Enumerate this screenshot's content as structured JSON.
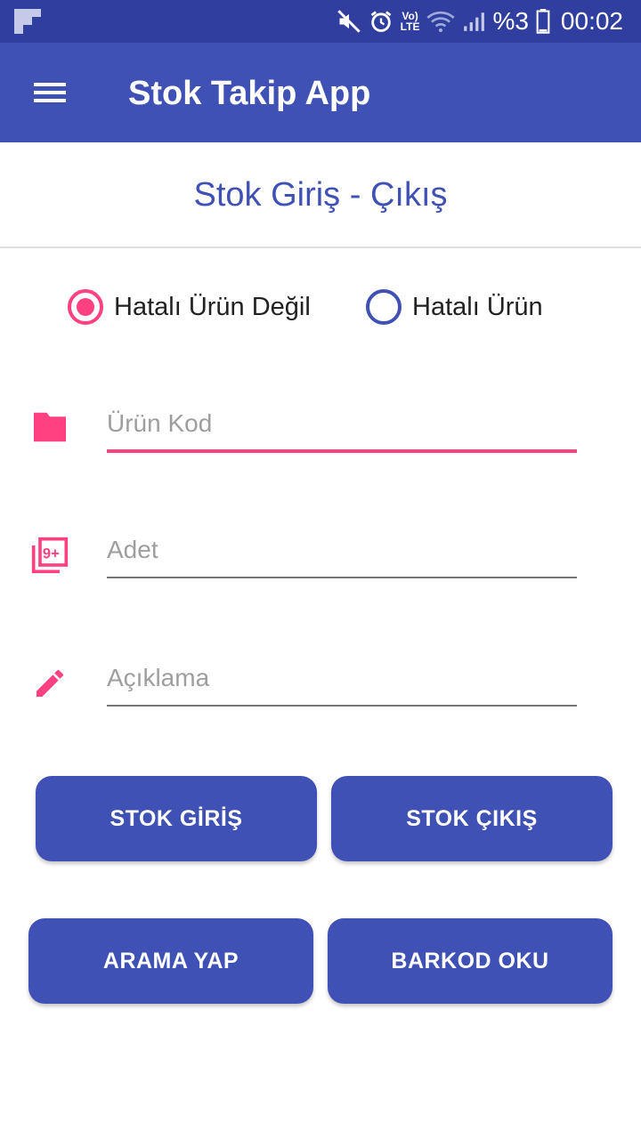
{
  "status_bar": {
    "battery_text": "%3",
    "clock": "00:02",
    "network_label_top": "Vo)",
    "network_label_bottom": "LTE"
  },
  "app_bar": {
    "title": "Stok Takip App",
    "menu_icon": "hamburger-menu-icon"
  },
  "page": {
    "title": "Stok Giriş - Çıkış"
  },
  "radio_group": {
    "options": [
      {
        "label": "Hatalı Ürün Değil",
        "checked": true
      },
      {
        "label": "Hatalı Ürün",
        "checked": false
      }
    ]
  },
  "form": {
    "fields": [
      {
        "icon": "folder-icon",
        "placeholder": "Ürün Kod",
        "value": ""
      },
      {
        "icon": "filter-9-plus-icon",
        "placeholder": "Adet",
        "value": ""
      },
      {
        "icon": "pencil-icon",
        "placeholder": "Açıklama",
        "value": ""
      }
    ]
  },
  "buttons": {
    "stock_in": "STOK GİRİŞ",
    "stock_out": "STOK ÇIKIŞ",
    "search": "ARAMA YAP",
    "barcode": "BARKOD OKU"
  },
  "colors": {
    "primary": "#3f51b5",
    "primary_dark": "#303f9f",
    "accent": "#ff4081"
  }
}
